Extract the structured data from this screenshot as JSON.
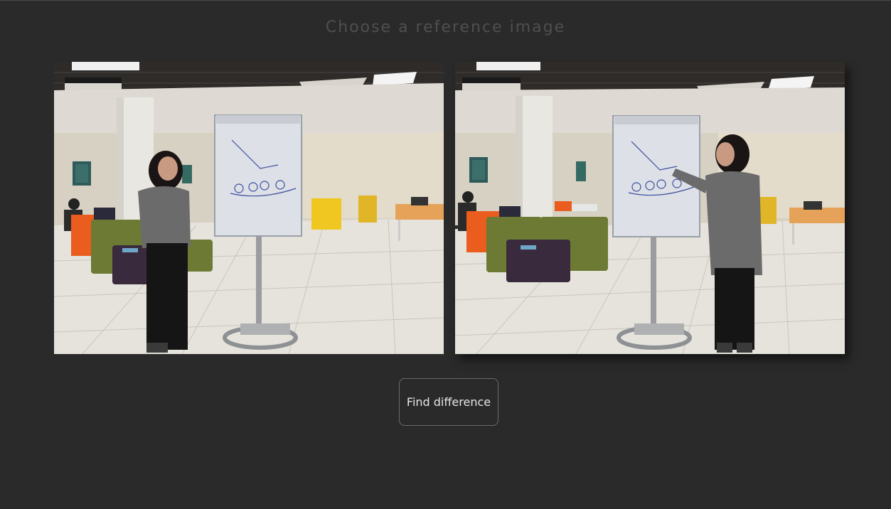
{
  "page": {
    "heading": "Choose a reference image",
    "find_button_label": "Find difference"
  },
  "images": [
    {
      "label": "reference-image-1",
      "description_shown": false
    },
    {
      "label": "reference-image-2",
      "description_shown": false
    }
  ],
  "colors": {
    "background": "#2a2a2a",
    "heading_text": "#4f4f4f",
    "button_text": "#e6e6e6",
    "button_border": "#6a6a6a"
  }
}
